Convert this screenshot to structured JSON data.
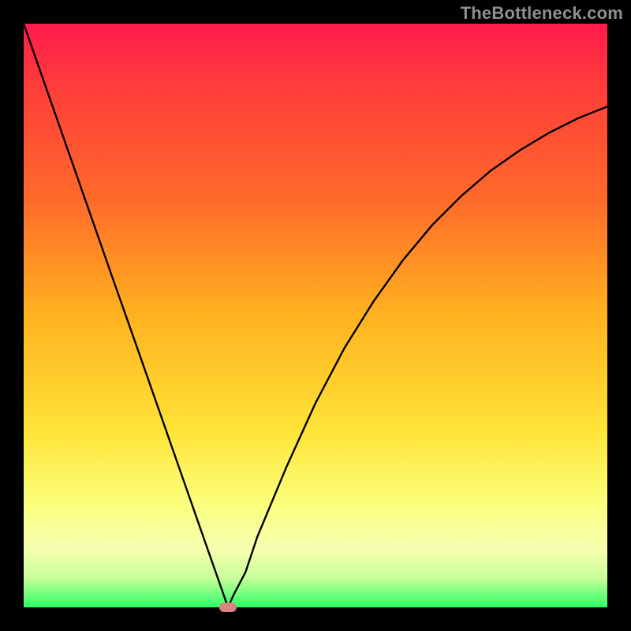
{
  "watermark": "TheBottleneck.com",
  "chart_data": {
    "type": "line",
    "title": "",
    "xlabel": "",
    "ylabel": "",
    "xlim": [
      0,
      100
    ],
    "ylim": [
      0,
      100
    ],
    "series": [
      {
        "name": "curve",
        "x": [
          0,
          5,
          10,
          15,
          20,
          25,
          30,
          32,
          34,
          35,
          36,
          38,
          40,
          45,
          50,
          55,
          60,
          65,
          70,
          75,
          80,
          85,
          90,
          95,
          100
        ],
        "values": [
          100,
          85.7,
          71.4,
          57.1,
          42.9,
          28.6,
          14.3,
          8.6,
          2.9,
          0,
          2.2,
          6,
          12,
          24,
          35,
          44.5,
          52.5,
          59.5,
          65.5,
          70.5,
          74.8,
          78.3,
          81.3,
          83.8,
          85.8
        ]
      }
    ],
    "marker": {
      "x": 35,
      "y": 0
    },
    "gradient_stops": [
      {
        "pos": 0,
        "color": "#ff1a4d"
      },
      {
        "pos": 10,
        "color": "#ff3b3b"
      },
      {
        "pos": 30,
        "color": "#ff6a2a"
      },
      {
        "pos": 50,
        "color": "#ffb21f"
      },
      {
        "pos": 70,
        "color": "#ffe438"
      },
      {
        "pos": 82,
        "color": "#fcff7a"
      },
      {
        "pos": 90,
        "color": "#f6ffb0"
      },
      {
        "pos": 95,
        "color": "#c8ff99"
      },
      {
        "pos": 100,
        "color": "#2cff66"
      }
    ]
  }
}
